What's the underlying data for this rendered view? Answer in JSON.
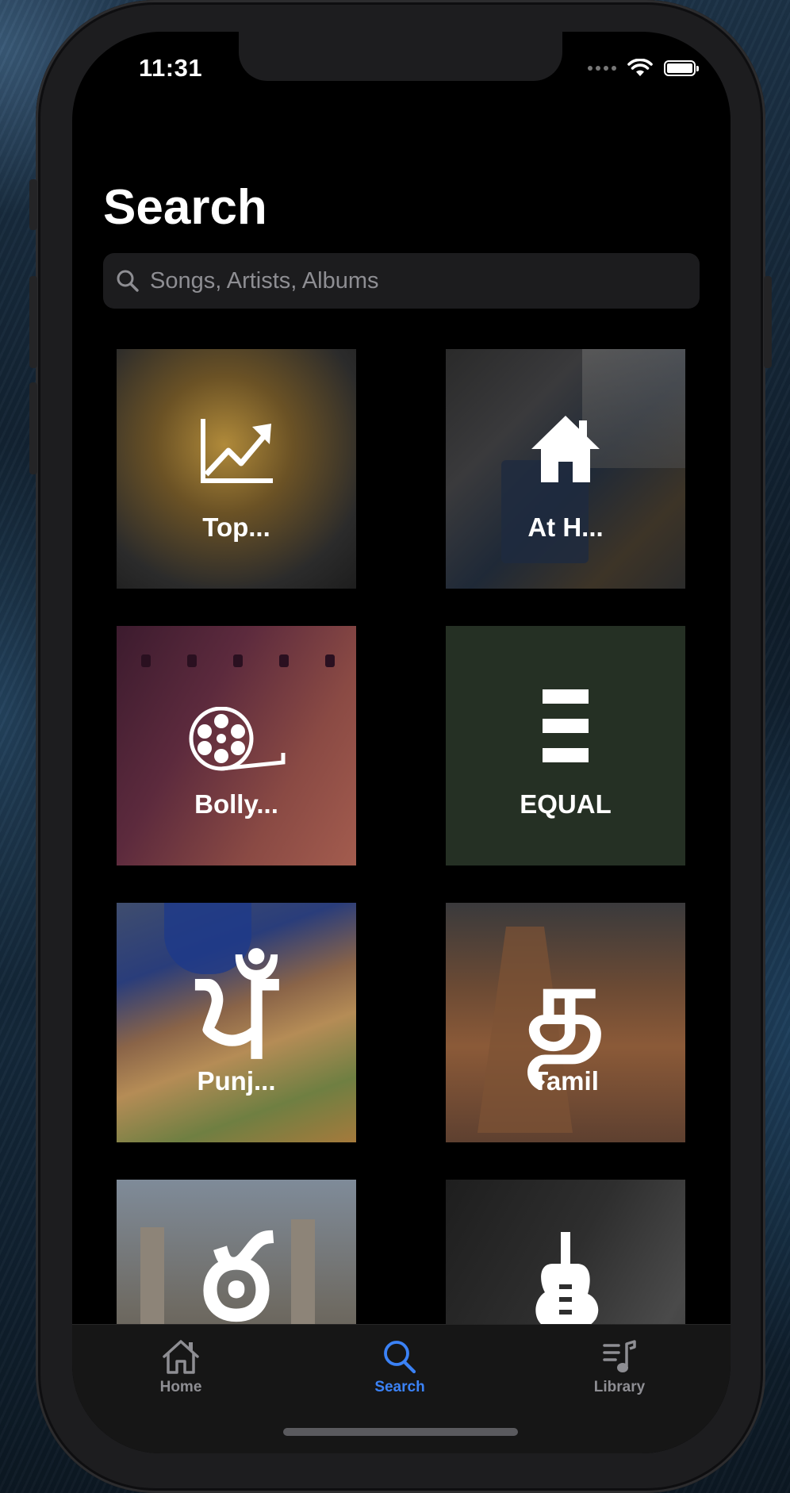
{
  "status_bar": {
    "time": "11:31"
  },
  "page": {
    "title": "Search"
  },
  "search": {
    "placeholder": "Songs, Artists, Albums"
  },
  "tiles": [
    {
      "label": "Top...",
      "icon": "trending-chart-icon"
    },
    {
      "label": "At H...",
      "icon": "house-icon"
    },
    {
      "label": "Bolly...",
      "icon": "film-reel-icon"
    },
    {
      "label": "EQUAL",
      "icon": "equal-stripes-icon"
    },
    {
      "label": "Punj...",
      "icon": "gurmukhi-letter-icon"
    },
    {
      "label": "Tamil",
      "icon": "tamil-letter-icon"
    },
    {
      "label": "",
      "icon": "telugu-letter-icon"
    },
    {
      "label": "",
      "icon": "electric-guitar-icon"
    }
  ],
  "tab_bar": {
    "home": "Home",
    "search": "Search",
    "library": "Library",
    "active": "search"
  },
  "colors": {
    "accent": "#3b82f6",
    "inactive": "#8e8e93",
    "background": "#000000"
  }
}
